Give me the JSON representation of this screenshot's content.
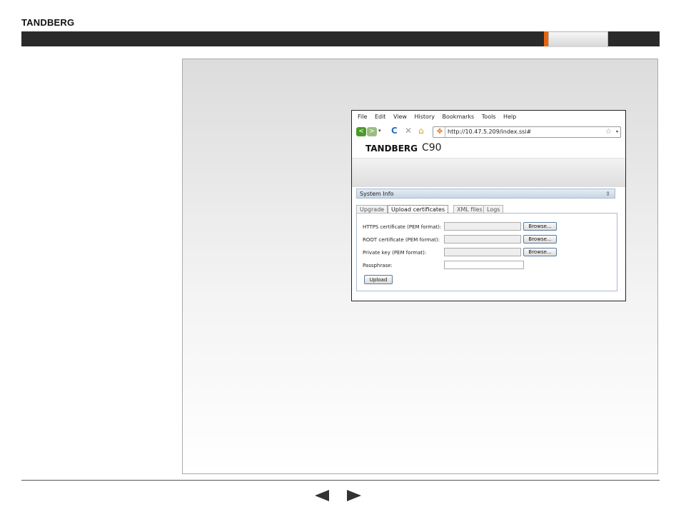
{
  "brand": "TANDBERG",
  "browser": {
    "menu": [
      "File",
      "Edit",
      "View",
      "History",
      "Bookmarks",
      "Tools",
      "Help"
    ],
    "back_glyph": "<",
    "forward_glyph": ">",
    "dropdown_glyph": "▾",
    "reload_glyph": "C",
    "stop_glyph": "✕",
    "home_glyph": "⌂",
    "site_icon_glyph": "✥",
    "url": "http://10.47.5.209/index.ssi#",
    "star_glyph": "☆",
    "url_dropdown_glyph": "▾"
  },
  "app": {
    "logo": "TANDBERG",
    "model": "C90",
    "section_title": "System Info",
    "section_toggle_glyph": "⇕",
    "tabs": [
      "Upgrade",
      "Upload certificates",
      "XML files",
      "Logs"
    ],
    "active_tab": "Upload certificates",
    "fields": [
      {
        "label": "HTTPS certificate (PEM format):",
        "value": "",
        "button": "Browse..."
      },
      {
        "label": "ROOT certificate (PEM format):",
        "value": "",
        "button": "Browse..."
      },
      {
        "label": "Private key (PEM format):",
        "value": "",
        "button": "Browse..."
      },
      {
        "label": "Passphrase:",
        "value": ""
      }
    ],
    "upload_button": "Upload"
  },
  "colors": {
    "accent": "#e8650f",
    "header_bar": "#2a2a2a",
    "back_button": "#4c9a2a"
  },
  "icons": {
    "prev": "triangle-left-icon",
    "next": "triangle-right-icon"
  }
}
